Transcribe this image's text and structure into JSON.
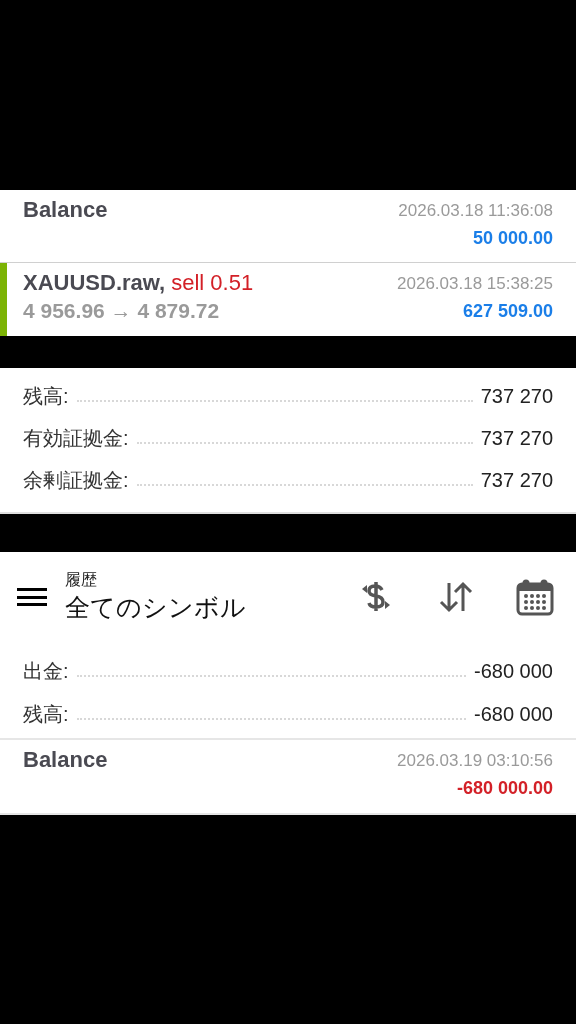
{
  "top_deals": [
    {
      "kind": "balance",
      "title": "Balance",
      "time": "2026.03.18 11:36:08",
      "amount": "50 000.00",
      "loss": false
    },
    {
      "kind": "trade",
      "title": "XAUUSD.raw,",
      "side": "sell 0.51",
      "prices": "4 956.96 → 4 879.72",
      "time": "2026.03.18 15:38:25",
      "amount": "627 509.00",
      "loss": false
    }
  ],
  "account_summary": [
    {
      "label": "残高:",
      "value": "737 270"
    },
    {
      "label": "有効証拠金:",
      "value": "737 270"
    },
    {
      "label": "余剰証拠金:",
      "value": "737 270"
    }
  ],
  "history": {
    "title": "履歴",
    "subtitle": "全てのシンボル",
    "summary": [
      {
        "label": "出金:",
        "value": "-680 000"
      },
      {
        "label": "残高:",
        "value": "-680 000"
      }
    ],
    "deals": [
      {
        "kind": "balance",
        "title": "Balance",
        "time": "2026.03.19 03:10:56",
        "amount": "-680 000.00",
        "loss": true
      }
    ]
  }
}
